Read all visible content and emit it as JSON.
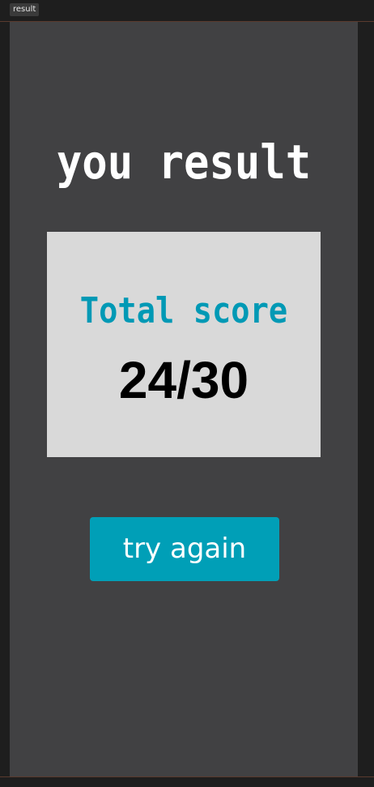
{
  "editor": {
    "frame_tag": "result"
  },
  "screen": {
    "title": "you result",
    "score_label": "Total score",
    "score_value": "24/30",
    "try_again_label": "try again"
  },
  "colors": {
    "background": "#414143",
    "card": "#d9d9d9",
    "accent": "#009fb7",
    "title_text": "#ffffff",
    "score_text": "#000000"
  }
}
